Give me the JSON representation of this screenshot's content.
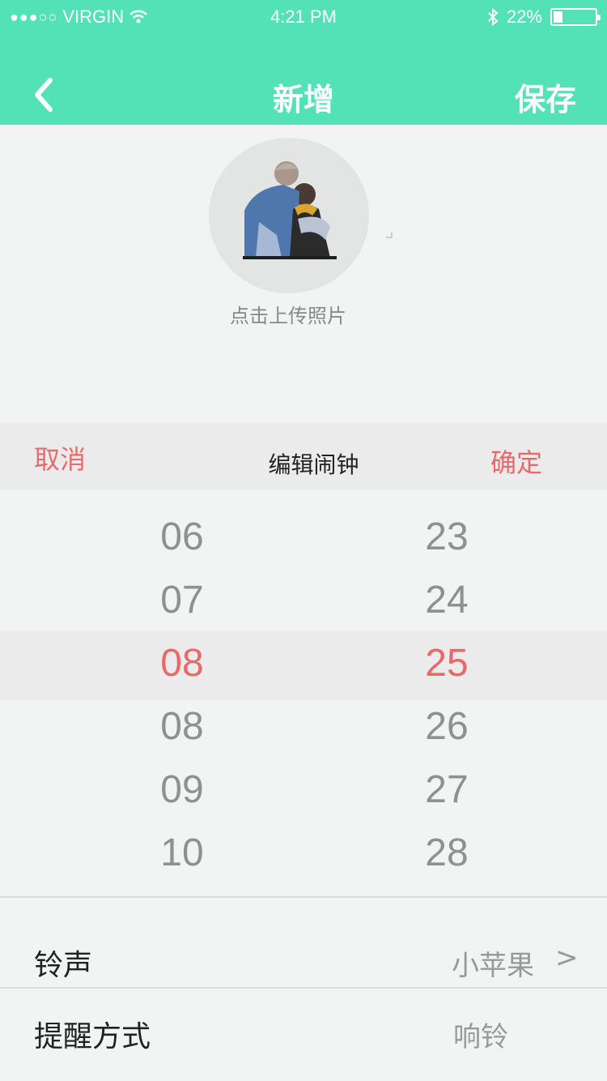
{
  "status_bar": {
    "signal": "●●●○○",
    "carrier": "VIRGIN",
    "wifi_icon": "wifi-icon",
    "time": "4:21 PM",
    "bluetooth_icon": "bluetooth-icon",
    "battery_percent": "22%",
    "battery_level": 0.22
  },
  "nav": {
    "back_icon": "chevron-left-icon",
    "title": "新增",
    "save_label": "保存"
  },
  "photo": {
    "upload_label": "点击上传照片"
  },
  "picker_toolbar": {
    "cancel_label": "取消",
    "title": "编辑闹钟",
    "confirm_label": "确定"
  },
  "time_picker": {
    "hours": [
      "06",
      "07",
      "08",
      "08",
      "09",
      "10"
    ],
    "minutes": [
      "23",
      "24",
      "25",
      "26",
      "27",
      "28"
    ],
    "selected_index": 2
  },
  "settings": {
    "ringtone_label": "铃声",
    "ringtone_value": "小苹果",
    "ringtone_chevron": ">",
    "reminder_label": "提醒方式",
    "reminder_value": "响铃"
  },
  "colors": {
    "brand": "#52e2b5",
    "accent": "#e96a6a",
    "background": "#f2f3f3"
  }
}
